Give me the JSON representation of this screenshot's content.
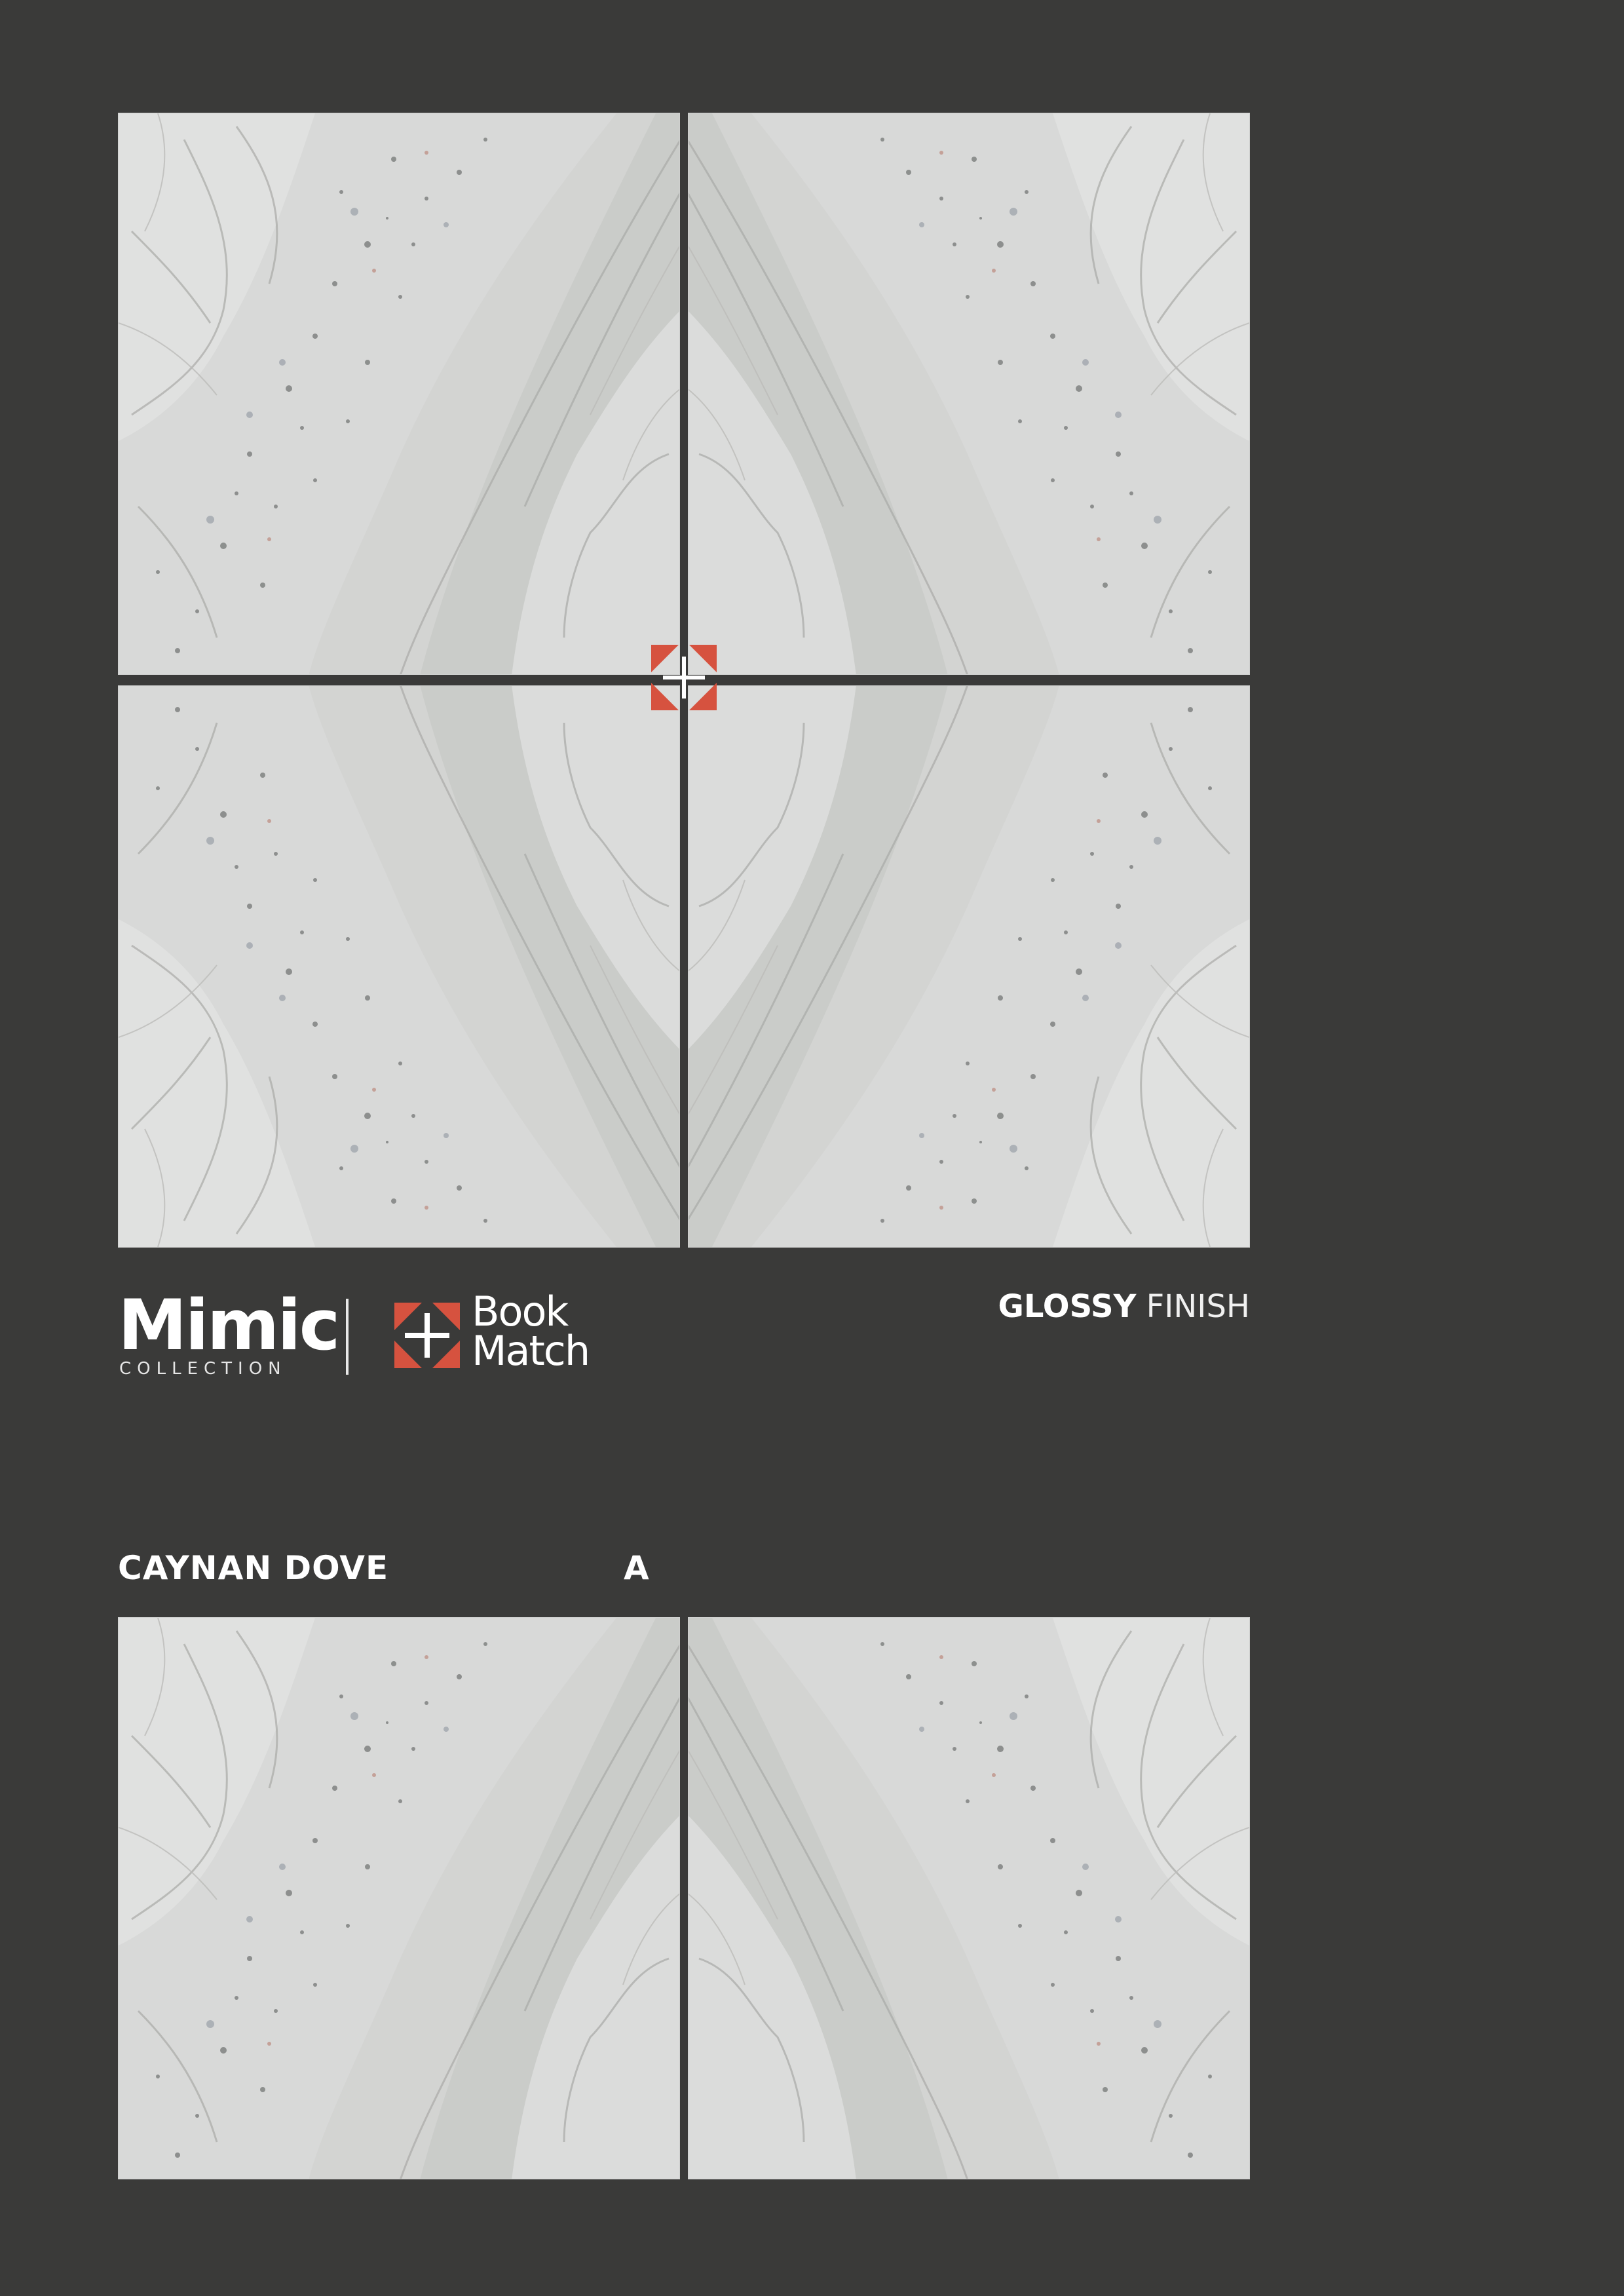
{
  "brand": {
    "collection_name": "Mimic",
    "collection_sub": "COLLECTION",
    "feature_line1": "Book",
    "feature_line2": "Match",
    "icon": "book-match-icon"
  },
  "finish": {
    "bold": "GLOSSY",
    "light": "FINISH"
  },
  "product": {
    "name": "CAYNAN DOVE",
    "variant": "A"
  },
  "colors": {
    "background": "#3a3a39",
    "accent": "#d6523f",
    "tile_base": "#d9dad9",
    "text": "#ffffff"
  }
}
